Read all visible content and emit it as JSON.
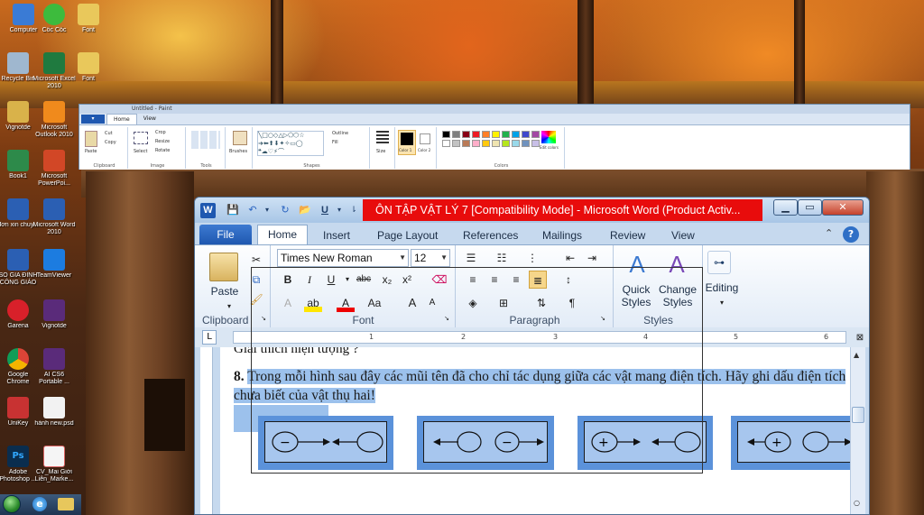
{
  "desktop": {
    "icons": [
      {
        "label": "Computer"
      },
      {
        "label": "Cốc Cốc"
      },
      {
        "label": "Font"
      },
      {
        "label": "Recycle Bin"
      },
      {
        "label": "Microsoft Excel 2010"
      },
      {
        "label": "Font"
      },
      {
        "label": "Vignotde"
      },
      {
        "label": "Microsoft Outlook 2010"
      },
      {
        "label": "Book1"
      },
      {
        "label": "Microsoft PowerPoi..."
      },
      {
        "label": "đơn xin chuy..."
      },
      {
        "label": "Microsoft Word 2010"
      },
      {
        "label": "SỔ GIA ĐÌNH CÔNG GIÁO"
      },
      {
        "label": "TeamViewer"
      },
      {
        "label": "Garena"
      },
      {
        "label": "Vignotde"
      },
      {
        "label": "Google Chrome"
      },
      {
        "label": "AI CS6 Portable ..."
      },
      {
        "label": "UniKey"
      },
      {
        "label": "hành new.psd"
      },
      {
        "label": "Adobe Photoshop ..."
      },
      {
        "label": "CV_Mai Giới Liên_Marke..."
      }
    ]
  },
  "paint": {
    "title": "Untitled - Paint",
    "tabs": [
      "Home",
      "View"
    ],
    "groups": [
      "Clipboard",
      "Image",
      "Tools",
      "Brushes",
      "Shapes",
      "Size",
      "Color 1",
      "Color 2",
      "Colors",
      "Edit colors"
    ],
    "buttons": {
      "paste": "Paste",
      "cut": "Cut",
      "copy": "Copy",
      "select": "Select",
      "crop": "Crop",
      "resize": "Resize",
      "rotate": "Rotate",
      "outline": "Outline",
      "fill": "Fill"
    },
    "colors": [
      "#000000",
      "#7f7f7f",
      "#880015",
      "#ed1c24",
      "#ff7f27",
      "#fff200",
      "#22b14c",
      "#00a2e8",
      "#3f48cc",
      "#a349a4",
      "#ffffff",
      "#c3c3c3",
      "#b97a57",
      "#ffaec9",
      "#ffc90e",
      "#efe4b0",
      "#b5e61d",
      "#99d9ea",
      "#7092be",
      "#c8bfe7"
    ]
  },
  "word": {
    "title": "ÔN TẬP VẬT LÝ 7 [Compatibility Mode]  -  Microsoft Word (Product Activ...",
    "tabs": {
      "file": "File",
      "home": "Home",
      "insert": "Insert",
      "page_layout": "Page Layout",
      "references": "References",
      "mailings": "Mailings",
      "review": "Review",
      "view": "View"
    },
    "ribbon": {
      "clipboard": {
        "label": "Clipboard",
        "paste": "Paste"
      },
      "font": {
        "label": "Font",
        "family": "Times New Roman",
        "size": "12"
      },
      "paragraph": {
        "label": "Paragraph"
      },
      "styles": {
        "label": "Styles",
        "quick_styles": "Quick Styles",
        "change_styles": "Change Styles"
      },
      "editing": {
        "label": "Editing"
      }
    },
    "ruler_ticks": [
      "1",
      "2",
      "3",
      "4",
      "5",
      "6"
    ],
    "document": {
      "previous_line": "Giải thích hiện tượng ?",
      "question_number": "8.",
      "question_text": "Trong mỗi hình sau đây các mũi tên đã cho chỉ tác dụng giữa các vật mang điện tích. Hãy ghi dấu điện tích chưa biết của vật thụ hai!"
    },
    "figures": [
      {
        "left_sign": "−",
        "right_sign": ""
      },
      {
        "left_sign": "",
        "right_sign": "−"
      },
      {
        "left_sign": "+",
        "right_sign": ""
      },
      {
        "left_sign": "+",
        "right_sign": ""
      }
    ]
  }
}
